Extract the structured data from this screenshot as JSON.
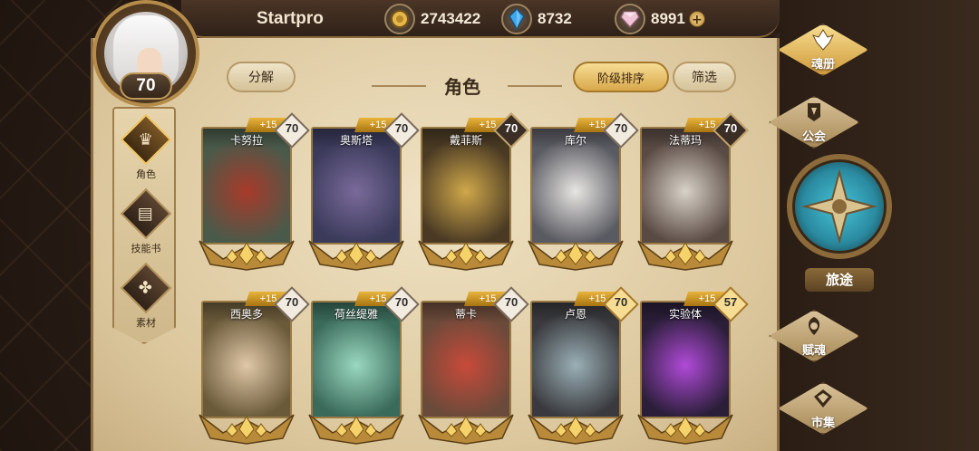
{
  "player": {
    "name": "Startpro",
    "level": "70"
  },
  "resources": {
    "gold": {
      "icon": "gold-coin-icon",
      "value": "2743422"
    },
    "crystal": {
      "icon": "blue-crystal-icon",
      "value": "8732"
    },
    "gem": {
      "icon": "pink-gem-icon",
      "value": "8991",
      "plus": "+"
    }
  },
  "left_nav": [
    {
      "label": "角色",
      "icon": "character-helm-icon",
      "active": true
    },
    {
      "label": "技能书",
      "icon": "skill-book-icon",
      "active": false
    },
    {
      "label": "素材",
      "icon": "material-beast-icon",
      "active": false
    }
  ],
  "header": {
    "decompose": "分解",
    "title": "角色",
    "sort": "阶级排序",
    "filter": "筛选"
  },
  "cards": [
    {
      "name": "卡努拉",
      "plus": "+15",
      "level": "70",
      "badge": "light",
      "colors": [
        "#4a5a4a",
        "#a83a2a"
      ]
    },
    {
      "name": "奥斯塔",
      "plus": "+15",
      "level": "70",
      "badge": "light",
      "colors": [
        "#3a3a5a",
        "#7a6a9a"
      ]
    },
    {
      "name": "戴菲斯",
      "plus": "+15",
      "level": "70",
      "badge": "dark",
      "colors": [
        "#4a3a24",
        "#d0a84a"
      ]
    },
    {
      "name": "库尔",
      "plus": "+15",
      "level": "70",
      "badge": "light",
      "colors": [
        "#5a5a62",
        "#e8e6e2"
      ]
    },
    {
      "name": "法蒂玛",
      "plus": "+15",
      "level": "70",
      "badge": "dark",
      "colors": [
        "#5a4a44",
        "#d8d2c8"
      ]
    },
    {
      "name": "西奥多",
      "plus": "+15",
      "level": "70",
      "badge": "light",
      "colors": [
        "#6a5a3a",
        "#e0c8a8"
      ]
    },
    {
      "name": "荷丝缇雅",
      "plus": "+15",
      "level": "70",
      "badge": "light",
      "colors": [
        "#3a6a5a",
        "#9ad8c0"
      ]
    },
    {
      "name": "蒂卡",
      "plus": "+15",
      "level": "70",
      "badge": "light",
      "colors": [
        "#6a4a3a",
        "#c84a3a"
      ]
    },
    {
      "name": "卢恩",
      "plus": "+15",
      "level": "70",
      "badge": "gold",
      "colors": [
        "#3a3a3e",
        "#9ab0b6"
      ]
    },
    {
      "name": "实验体",
      "plus": "+15",
      "level": "57",
      "badge": "gold",
      "colors": [
        "#2a1e38",
        "#b04ad8"
      ]
    }
  ],
  "right_nav": [
    {
      "label": "魂册",
      "icon": "soul-book-icon",
      "active": true
    },
    {
      "label": "公会",
      "icon": "guild-banner-icon",
      "active": false
    },
    {
      "label": "旅途",
      "icon": "journey-compass-icon",
      "active": false
    },
    {
      "label": "赋魂",
      "icon": "soul-infuse-icon",
      "active": false
    },
    {
      "label": "市集",
      "icon": "market-gem-icon",
      "active": false
    }
  ]
}
